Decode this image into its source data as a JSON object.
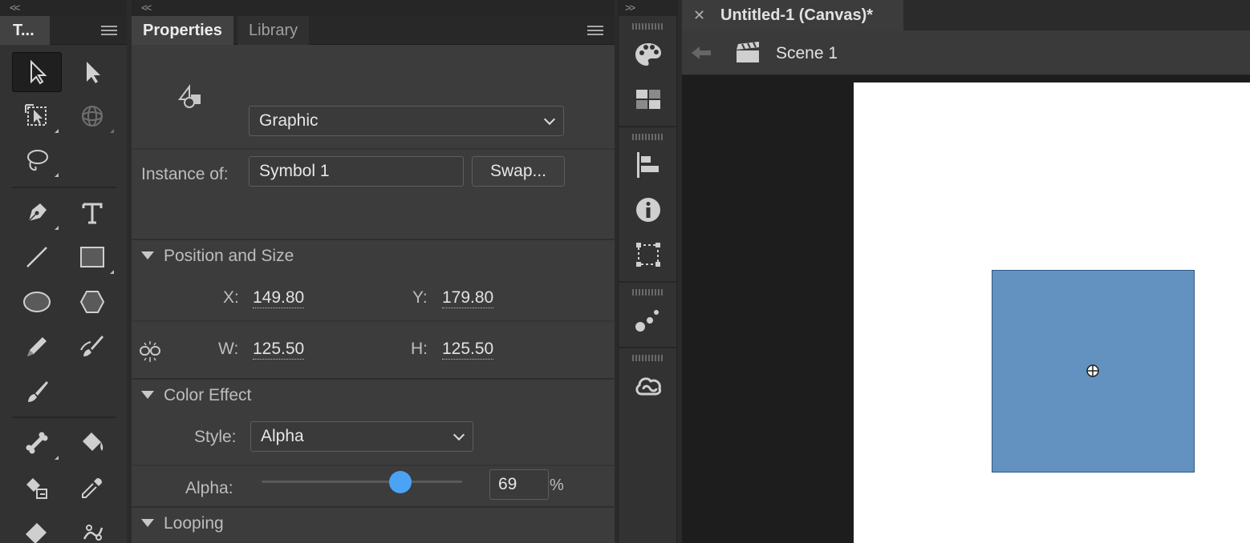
{
  "tools_panel": {
    "collapse_label": "<<",
    "tab_label": "T...",
    "tools": [
      {
        "name": "selection-tool",
        "icon": "selection-arrow-icon",
        "selected": true
      },
      {
        "name": "subselection-tool",
        "icon": "subselection-arrow-icon"
      },
      {
        "name": "free-transform-tool",
        "icon": "free-transform-icon"
      },
      {
        "name": "3d-rotation-tool",
        "icon": "3d-rotation-icon"
      },
      {
        "name": "lasso-tool",
        "icon": "lasso-icon"
      },
      {
        "name": "pen-tool",
        "icon": "pen-icon"
      },
      {
        "name": "text-tool",
        "icon": "text-icon"
      },
      {
        "name": "line-tool",
        "icon": "line-icon"
      },
      {
        "name": "rectangle-tool",
        "icon": "rectangle-icon"
      },
      {
        "name": "oval-tool",
        "icon": "oval-icon"
      },
      {
        "name": "polystar-tool",
        "icon": "polystar-icon"
      },
      {
        "name": "pencil-tool",
        "icon": "pencil-icon"
      },
      {
        "name": "brush-tool",
        "icon": "paint-brush-icon"
      },
      {
        "name": "classic-brush-tool",
        "icon": "brush-icon"
      },
      {
        "name": "bone-tool",
        "icon": "bone-icon"
      },
      {
        "name": "paint-bucket-tool",
        "icon": "paint-bucket-icon"
      },
      {
        "name": "ink-bottle-tool",
        "icon": "ink-bottle-icon"
      },
      {
        "name": "eyedropper-tool",
        "icon": "eyedropper-icon"
      },
      {
        "name": "eraser-tool",
        "icon": "eraser-icon"
      },
      {
        "name": "asset-warp-tool",
        "icon": "asset-warp-icon"
      }
    ]
  },
  "properties_panel": {
    "collapse_label": "<<",
    "tabs": [
      {
        "label": "Properties",
        "active": true
      },
      {
        "label": "Library",
        "active": false
      }
    ],
    "symbol_type": "Graphic",
    "instance_of_label": "Instance of:",
    "instance_of_value": "Symbol 1",
    "swap_label": "Swap...",
    "position_size": {
      "header": "Position and Size",
      "x_label": "X:",
      "x_value": "149.80",
      "y_label": "Y:",
      "y_value": "179.80",
      "w_label": "W:",
      "w_value": "125.50",
      "h_label": "H:",
      "h_value": "125.50"
    },
    "color_effect": {
      "header": "Color Effect",
      "style_label": "Style:",
      "style_value": "Alpha",
      "alpha_label": "Alpha:",
      "alpha_value": "69",
      "alpha_unit": "%",
      "alpha_fraction": 0.69
    },
    "looping": {
      "header": "Looping"
    }
  },
  "dock": {
    "collapse_label": ">>",
    "buttons": [
      "color-palette-icon",
      "swatches-icon",
      "align-icon",
      "info-icon",
      "transform-icon",
      "motion-presets-icon",
      "creative-cloud-libraries-icon"
    ]
  },
  "document": {
    "tab_title": "Untitled-1 (Canvas)*",
    "close_glyph": "✕",
    "scene_name": "Scene 1"
  },
  "colors": {
    "symbol_fill": "#6392c0",
    "slider_thumb": "#4aa3f5",
    "stage_background": "#ffffff"
  }
}
